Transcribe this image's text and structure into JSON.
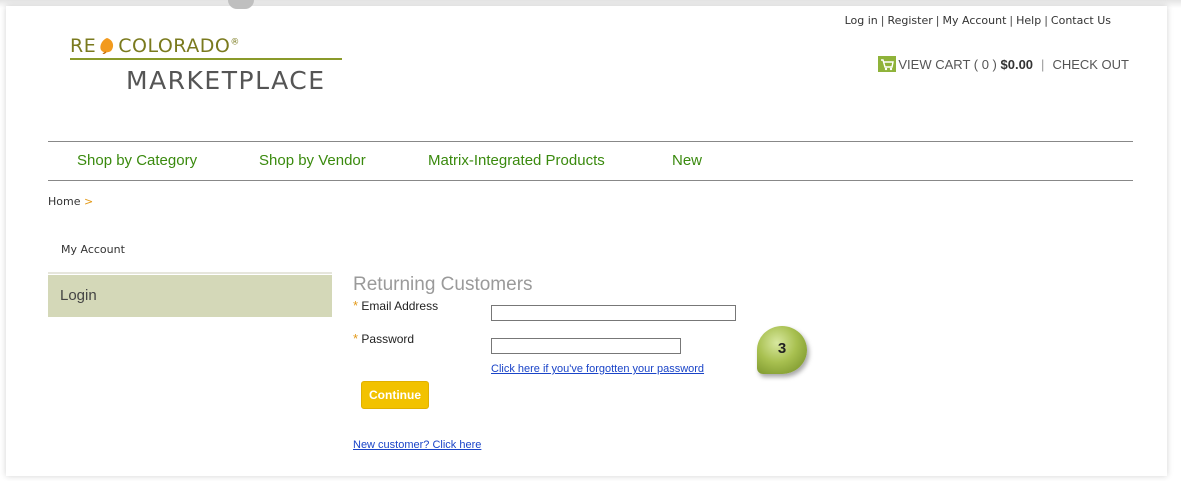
{
  "header": {
    "top_links": [
      "Log in",
      "Register",
      "My Account",
      "Help",
      "Contact Us"
    ],
    "logo": {
      "line1": "RE COLORADO",
      "trademark": "®",
      "line2": "MARKETPLACE"
    },
    "cart": {
      "view_cart_label": "VIEW CART ( 0 )",
      "amount": "$0.00",
      "separator": "|",
      "checkout_label": "CHECK OUT"
    }
  },
  "nav": {
    "items": [
      "Shop by Category",
      "Shop by Vendor",
      "Matrix-Integrated Products",
      "New"
    ]
  },
  "breadcrumb": {
    "home": "Home",
    "arrow": ">"
  },
  "sidebar": {
    "title": "My Account",
    "active_item": "Login"
  },
  "form": {
    "title": "Returning Customers",
    "required_mark": "*",
    "email_label": "Email Address",
    "email_value": "",
    "password_label": "Password",
    "password_value": "",
    "forgot_link": "Click here if you've forgotten your password",
    "continue_button": "Continue",
    "new_customer_link": "New customer? Click here"
  },
  "step_badge": "3",
  "colors": {
    "nav_green": "#3a8a0e",
    "accent_orange": "#e39a1a",
    "button_yellow": "#f2c200",
    "sidebar_active": "#d4d8b8",
    "link_blue": "#1a44c8"
  }
}
